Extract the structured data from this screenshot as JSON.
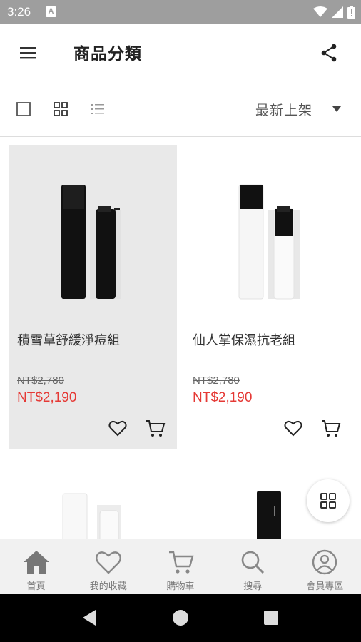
{
  "status_bar": {
    "time": "3:26",
    "notification_letter": "A"
  },
  "header": {
    "title": "商品分類"
  },
  "toolbar": {
    "sort_selected": "最新上架"
  },
  "products": [
    {
      "name": "積雪草舒緩淨痘組",
      "price_original": "NT$2,780",
      "price_sale": "NT$2,190",
      "selected": true,
      "color": "#111111"
    },
    {
      "name": "仙人掌保濕抗老組",
      "price_original": "NT$2,780",
      "price_sale": "NT$2,190",
      "selected": false,
      "color": "#ffffff"
    }
  ],
  "bottom_nav": {
    "items": [
      {
        "label": "首頁",
        "icon": "home-icon"
      },
      {
        "label": "我的收藏",
        "icon": "heart-icon"
      },
      {
        "label": "購物車",
        "icon": "cart-icon"
      },
      {
        "label": "搜尋",
        "icon": "search-icon"
      },
      {
        "label": "會員專區",
        "icon": "user-icon"
      }
    ]
  },
  "colors": {
    "sale_price": "#e53935",
    "status_bar": "#9e9e9e",
    "selected_card": "#e9e9e9",
    "nav_icon": "#888888"
  }
}
